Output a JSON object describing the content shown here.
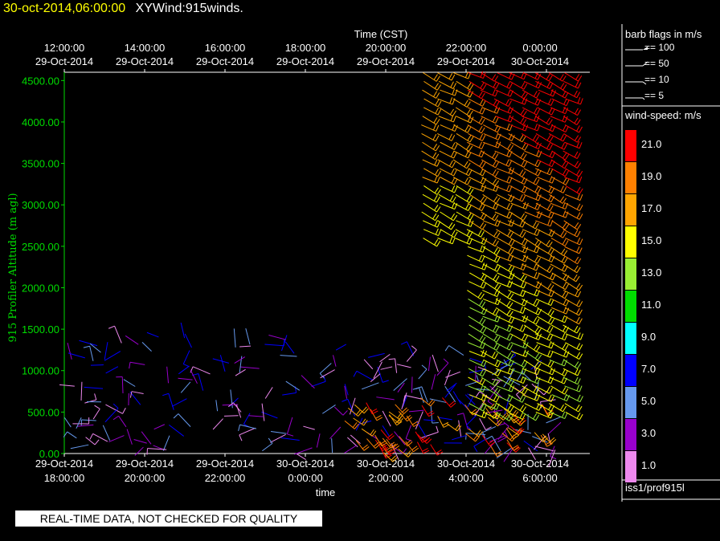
{
  "title": {
    "date": "30-oct-2014,06:00:00",
    "name": "XYWind:915winds."
  },
  "disclaimer": "REAL-TIME DATA, NOT CHECKED FOR QUALITY",
  "source": "iss1/prof915l",
  "barb_legend": {
    "title": "barb flags in m/s",
    "items": [
      "== 100",
      "== 50",
      "== 10",
      "== 5"
    ]
  },
  "speed_legend": {
    "title": "wind-speed: m/s",
    "bins": [
      {
        "label": "21.0",
        "color": "#ff0000"
      },
      {
        "label": "19.0",
        "color": "#ff8000"
      },
      {
        "label": "17.0",
        "color": "#ffa500"
      },
      {
        "label": "15.0",
        "color": "#ffff00"
      },
      {
        "label": "13.0",
        "color": "#99ee33"
      },
      {
        "label": "11.0",
        "color": "#00dd00"
      },
      {
        "label": "9.0",
        "color": "#00ffff"
      },
      {
        "label": "7.0",
        "color": "#0000ff"
      },
      {
        "label": "5.0",
        "color": "#6699ee"
      },
      {
        "label": "3.0",
        "color": "#9900cc"
      },
      {
        "label": "1.0",
        "color": "#ee88ee"
      }
    ]
  },
  "chart_data": {
    "type": "wind barb time-height plot",
    "top_axis_title": "Time (CST)",
    "bottom_axis_title": "time",
    "ylabel": "915 Profiler Altitude (m agl)",
    "ylim": [
      0,
      4600
    ],
    "yticks": [
      "0.00",
      "500.00",
      "1000.00",
      "1500.00",
      "2000.00",
      "2500.00",
      "3000.00",
      "3500.00",
      "4000.00",
      "4500.00"
    ],
    "top_ticks": [
      {
        "time": "12:00:00",
        "date": "29-Oct-2014"
      },
      {
        "time": "14:00:00",
        "date": "29-Oct-2014"
      },
      {
        "time": "16:00:00",
        "date": "29-Oct-2014"
      },
      {
        "time": "18:00:00",
        "date": "29-Oct-2014"
      },
      {
        "time": "20:00:00",
        "date": "29-Oct-2014"
      },
      {
        "time": "22:00:00",
        "date": "29-Oct-2014"
      },
      {
        "time": "0:00:00",
        "date": "30-Oct-2014"
      }
    ],
    "bottom_ticks": [
      {
        "date": "29-Oct-2014",
        "time": "18:00:00"
      },
      {
        "date": "29-Oct-2014",
        "time": "20:00:00"
      },
      {
        "date": "29-Oct-2014",
        "time": "22:00:00"
      },
      {
        "date": "30-Oct-2014",
        "time": "0:00:00"
      },
      {
        "date": "30-Oct-2014",
        "time": "2:00:00"
      },
      {
        "date": "30-Oct-2014",
        "time": "4:00:00"
      },
      {
        "date": "30-Oct-2014",
        "time": "6:00:00"
      }
    ]
  }
}
